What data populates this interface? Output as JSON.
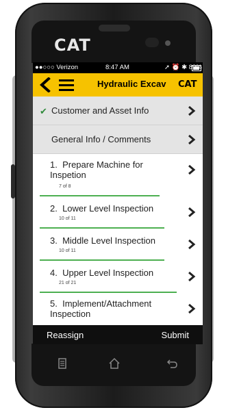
{
  "device": {
    "brand": "CAT"
  },
  "status_bar": {
    "carrier": "●●○○○ Verizon",
    "time": "8:47 AM",
    "battery": "89%"
  },
  "header": {
    "title": "Hydraulic Excav",
    "logo": "CAT"
  },
  "sections": [
    {
      "label": "Customer and Asset Info",
      "completed": true
    },
    {
      "label": "General Info / Comments",
      "completed": false
    }
  ],
  "inspections": [
    {
      "number": "1.",
      "label": "Prepare Machine for Inspetion",
      "progress_text": "7 of 8",
      "progress": 0.875
    },
    {
      "number": "2.",
      "label": "Lower Level Inspection",
      "progress_text": "10 of 11",
      "progress": 0.909
    },
    {
      "number": "3.",
      "label": "Middle Level Inspection",
      "progress_text": "10 of 11",
      "progress": 0.909
    },
    {
      "number": "4.",
      "label": "Upper Level Inspection",
      "progress_text": "21 of 21",
      "progress": 1.0
    },
    {
      "number": "5.",
      "label": "Implement/Attachment Inspection",
      "progress_text": "",
      "progress": 0
    }
  ],
  "actions": {
    "reassign": "Reassign",
    "submit": "Submit"
  },
  "colors": {
    "header": "#f6c200",
    "progress": "#4caf50",
    "check": "#2f8a3b"
  }
}
